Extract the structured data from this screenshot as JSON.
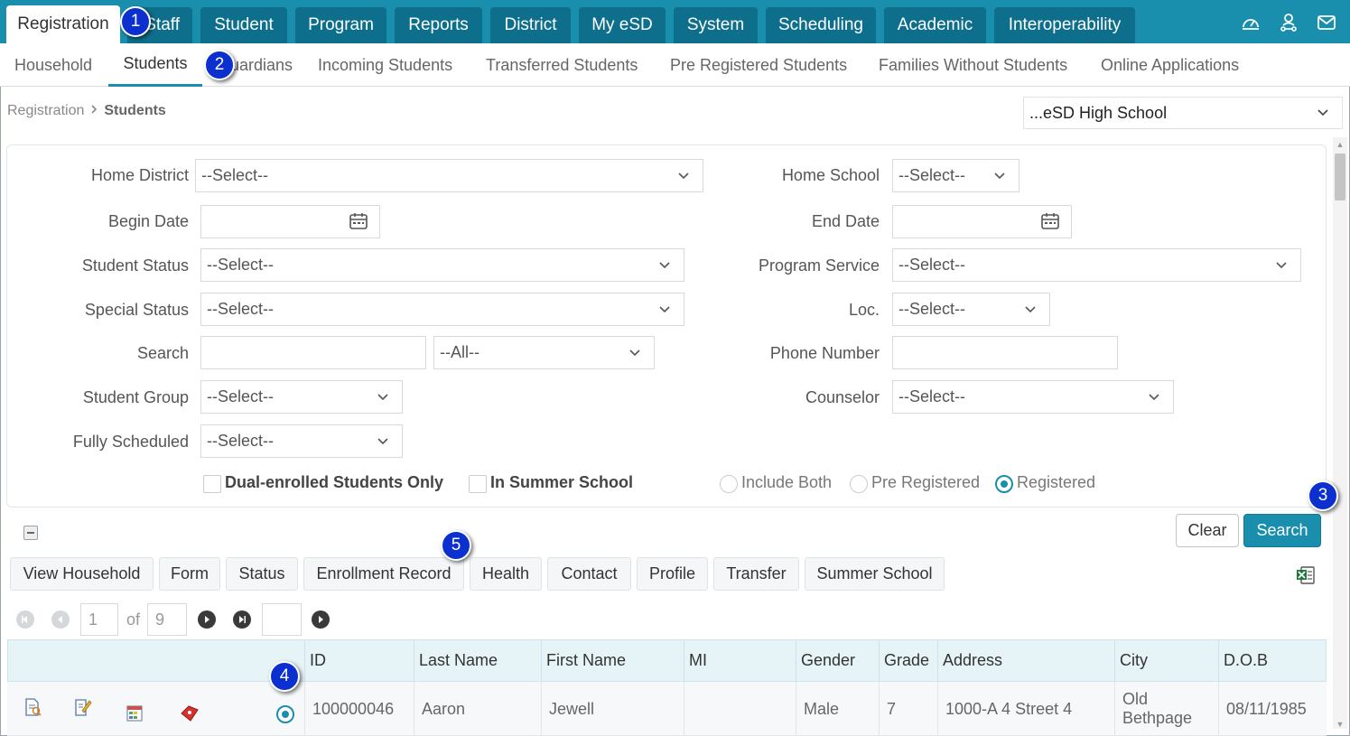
{
  "top_tabs": [
    {
      "label": "Registration",
      "active": true
    },
    {
      "label": "Staff"
    },
    {
      "label": "Student"
    },
    {
      "label": "Program"
    },
    {
      "label": "Reports"
    },
    {
      "label": "District"
    },
    {
      "label": "My eSD"
    },
    {
      "label": "System"
    },
    {
      "label": "Scheduling"
    },
    {
      "label": "Academic"
    },
    {
      "label": "Interoperability"
    }
  ],
  "top_icons": [
    "dashboard-icon",
    "user-network-icon",
    "mail-icon"
  ],
  "sub_tabs": [
    {
      "label": "Household"
    },
    {
      "label": "Students",
      "active": true
    },
    {
      "label": "Guardians"
    },
    {
      "label": "Incoming Students"
    },
    {
      "label": "Transferred Students"
    },
    {
      "label": "Pre Registered Students"
    },
    {
      "label": "Families Without Students"
    },
    {
      "label": "Online Applications"
    }
  ],
  "breadcrumb": {
    "root": "Registration",
    "current": "Students"
  },
  "school_selector": {
    "value": "...eSD High School"
  },
  "filters": {
    "home_district": {
      "label": "Home District",
      "value": "--Select--"
    },
    "home_school": {
      "label": "Home School",
      "value": "--Select--"
    },
    "begin_date": {
      "label": "Begin Date",
      "value": ""
    },
    "end_date": {
      "label": "End Date",
      "value": ""
    },
    "student_status": {
      "label": "Student Status",
      "value": "--Select--"
    },
    "program_service": {
      "label": "Program Service",
      "value": "--Select--"
    },
    "special_status": {
      "label": "Special Status",
      "value": "--Select--"
    },
    "loc": {
      "label": "Loc.",
      "value": "--Select--"
    },
    "search": {
      "label": "Search",
      "value": "",
      "scope": "--All--"
    },
    "phone_number": {
      "label": "Phone Number",
      "value": ""
    },
    "student_group": {
      "label": "Student Group",
      "value": "--Select--"
    },
    "counselor": {
      "label": "Counselor",
      "value": "--Select--"
    },
    "fully_scheduled": {
      "label": "Fully Scheduled",
      "value": "--Select--"
    },
    "dual_enrolled": {
      "label": "Dual-enrolled Students Only",
      "checked": false
    },
    "summer_school": {
      "label": "In Summer School",
      "checked": false
    },
    "registration_radio": {
      "options": [
        "Include Both",
        "Pre Registered",
        "Registered"
      ],
      "selected": "Registered"
    }
  },
  "buttons": {
    "clear": "Clear",
    "search": "Search"
  },
  "action_buttons": [
    "View Household",
    "Form",
    "Status",
    "Enrollment Record",
    "Health",
    "Contact",
    "Profile",
    "Transfer",
    "Summer School"
  ],
  "pager": {
    "page": "1",
    "of_label": "of",
    "total_pages": "9",
    "goto": ""
  },
  "table": {
    "columns": [
      "ID",
      "Last Name",
      "First Name",
      "MI",
      "Gender",
      "Grade",
      "Address",
      "City",
      "D.O.B"
    ],
    "rows": [
      {
        "id": "100000046",
        "last_name": "Aaron",
        "first_name": "Jewell",
        "mi": "",
        "gender": "Male",
        "grade": "7",
        "address": "1000-A 4 Street 4",
        "city_line1": "Old",
        "city_line2": "Bethpage",
        "dob": "08/11/1985"
      }
    ]
  },
  "callouts": [
    "1",
    "2",
    "3",
    "4",
    "5"
  ],
  "colors": {
    "primary": "#1a8fad",
    "primary_dark": "#0e6f8c",
    "callout": "#0c2fd0"
  }
}
